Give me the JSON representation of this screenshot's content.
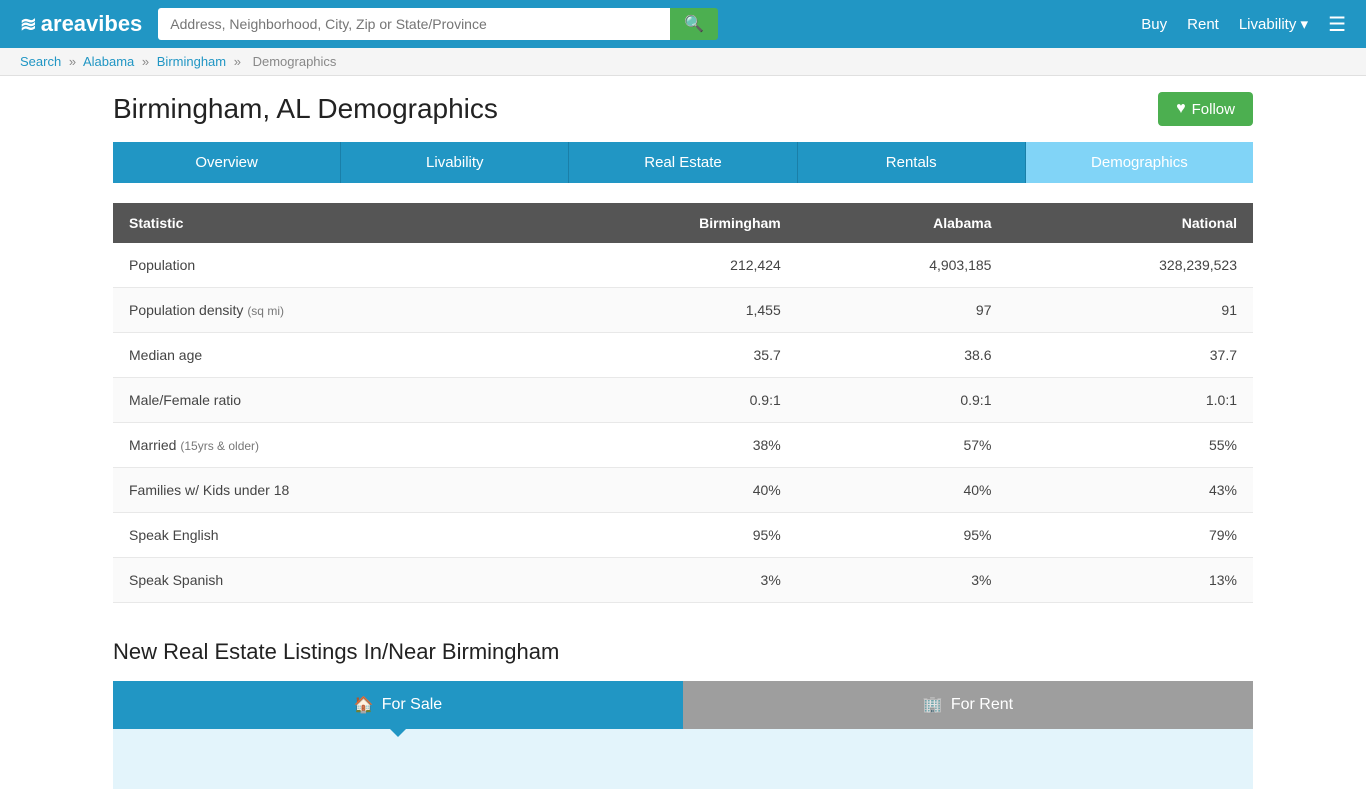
{
  "header": {
    "logo_text": "areavibes",
    "search_placeholder": "Address, Neighborhood, City, Zip or State/Province",
    "nav": {
      "buy": "Buy",
      "rent": "Rent",
      "livability": "Livability ▾"
    }
  },
  "breadcrumb": {
    "search": "Search",
    "state": "Alabama",
    "city": "Birmingham",
    "current": "Demographics",
    "sep": "»"
  },
  "page": {
    "title": "Birmingham, AL Demographics",
    "follow_label": "Follow"
  },
  "tabs": [
    {
      "label": "Overview",
      "active": false
    },
    {
      "label": "Livability",
      "active": false
    },
    {
      "label": "Real Estate",
      "active": false
    },
    {
      "label": "Rentals",
      "active": false
    },
    {
      "label": "Demographics",
      "active": true
    }
  ],
  "table": {
    "headers": {
      "statistic": "Statistic",
      "birmingham": "Birmingham",
      "alabama": "Alabama",
      "national": "National"
    },
    "rows": [
      {
        "label": "Population",
        "sub": "",
        "birmingham": "212,424",
        "alabama": "4,903,185",
        "national": "328,239,523"
      },
      {
        "label": "Population density",
        "sub": "(sq mi)",
        "birmingham": "1,455",
        "alabama": "97",
        "national": "91"
      },
      {
        "label": "Median age",
        "sub": "",
        "birmingham": "35.7",
        "alabama": "38.6",
        "national": "37.7"
      },
      {
        "label": "Male/Female ratio",
        "sub": "",
        "birmingham": "0.9:1",
        "alabama": "0.9:1",
        "national": "1.0:1"
      },
      {
        "label": "Married",
        "sub": "(15yrs & older)",
        "birmingham": "38%",
        "alabama": "57%",
        "national": "55%"
      },
      {
        "label": "Families w/ Kids under 18",
        "sub": "",
        "birmingham": "40%",
        "alabama": "40%",
        "national": "43%"
      },
      {
        "label": "Speak English",
        "sub": "",
        "birmingham": "95%",
        "alabama": "95%",
        "national": "79%"
      },
      {
        "label": "Speak Spanish",
        "sub": "",
        "birmingham": "3%",
        "alabama": "3%",
        "national": "13%"
      }
    ]
  },
  "listings": {
    "title": "New Real Estate Listings In/Near Birmingham",
    "for_sale": "For Sale",
    "for_rent": "For Rent"
  }
}
